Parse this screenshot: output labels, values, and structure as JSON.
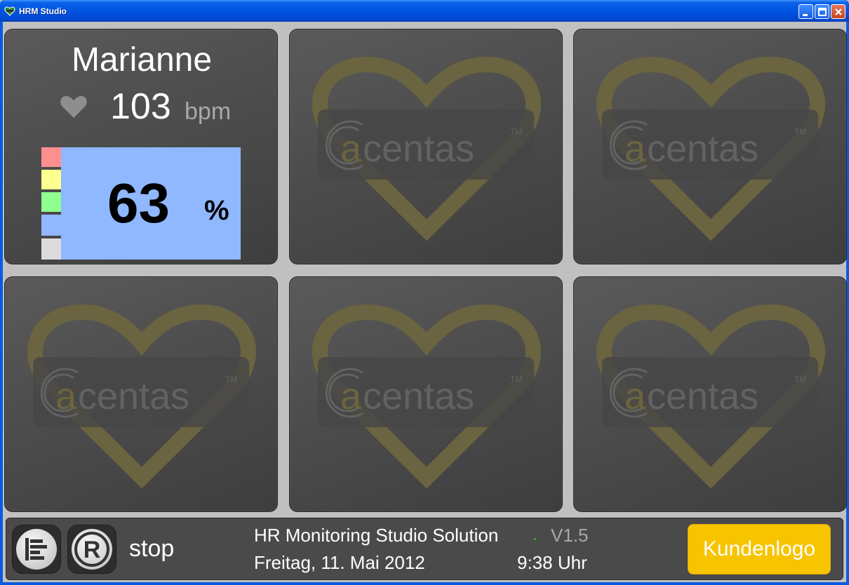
{
  "window": {
    "title": "HRM Studio"
  },
  "participant": {
    "name": "Marianne",
    "heart_rate": "103",
    "heart_rate_unit": "bpm",
    "intensity": "63",
    "intensity_unit": "%"
  },
  "zones": [
    {
      "name": "zone-5",
      "color": "#ff8f8f"
    },
    {
      "name": "zone-4",
      "color": "#ffff8f"
    },
    {
      "name": "zone-3",
      "color": "#8fff8f"
    },
    {
      "name": "zone-2",
      "color": "#8fb8ff"
    },
    {
      "name": "zone-1",
      "color": "#dcdcdc"
    }
  ],
  "watermark": {
    "text": "acentas",
    "tm": "TM"
  },
  "footer": {
    "state": "stop",
    "product": "HR Monitoring Studio Solution",
    "version": "V1.5",
    "date": "Freitag, 11. Mai 2012",
    "time": "9:38 Uhr",
    "logo_button": "Kundenlogo"
  },
  "colors": {
    "accent_logo": "#f7c400",
    "active_intensity": "#8fb8ff",
    "watermark_heart": "#6b6440"
  },
  "icons": [
    "app-icon",
    "minimize-icon",
    "maximize-icon",
    "close-icon",
    "heart-icon",
    "menu-icon",
    "register-icon"
  ]
}
